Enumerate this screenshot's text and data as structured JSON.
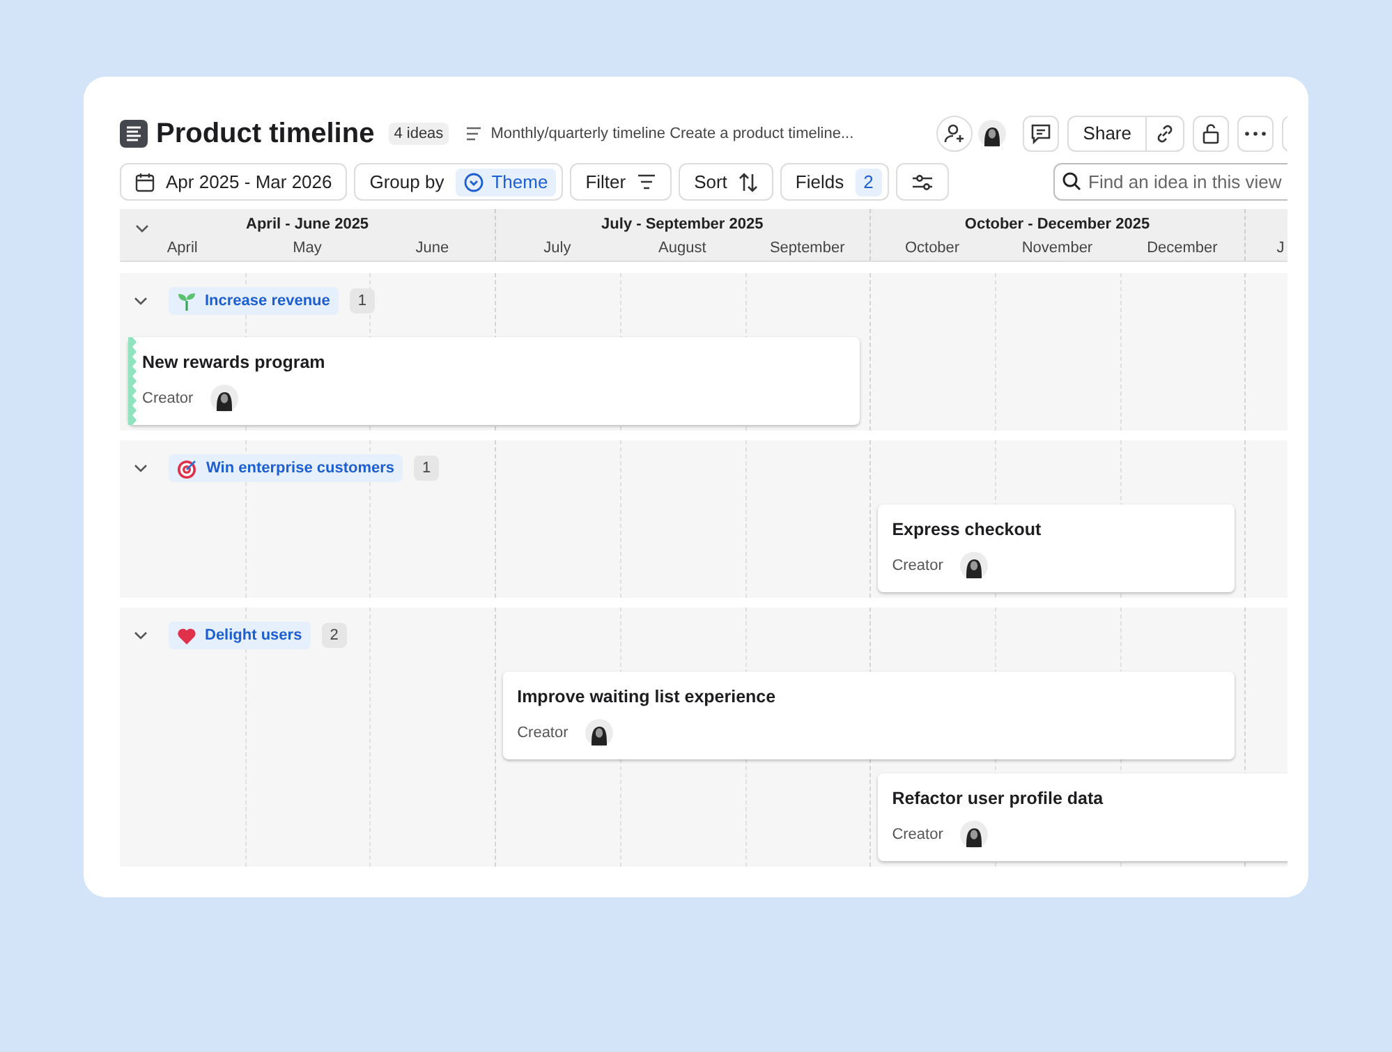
{
  "header": {
    "title": "Product timeline",
    "count_badge": "4 ideas",
    "description": "Monthly/quarterly timeline Create a product timeline...",
    "share_label": "Share"
  },
  "toolbar": {
    "date_range": "Apr 2025 - Mar 2026",
    "group_by_label": "Group by",
    "group_by_value": "Theme",
    "filter_label": "Filter",
    "sort_label": "Sort",
    "fields_label": "Fields",
    "fields_count": "2",
    "search": {
      "placeholder": "Find an idea in this view"
    }
  },
  "timeline": {
    "quarters": [
      {
        "label": "April - June 2025",
        "months": [
          "April",
          "May",
          "June"
        ]
      },
      {
        "label": "July - September 2025",
        "months": [
          "July",
          "August",
          "September"
        ]
      },
      {
        "label": "October - December 2025",
        "months": [
          "October",
          "November",
          "December"
        ]
      },
      {
        "months": [
          "J"
        ]
      }
    ],
    "groups": [
      {
        "label": "Increase revenue",
        "kind": "sprout",
        "count": "1",
        "expanded": true,
        "ideas": [
          {
            "title": "New rewards program",
            "field_label": "Creator",
            "continues_before": true
          }
        ]
      },
      {
        "label": "Win enterprise customers",
        "kind": "target",
        "count": "1",
        "expanded": true,
        "ideas": [
          {
            "title": "Express checkout",
            "field_label": "Creator",
            "continues_before": false
          }
        ]
      },
      {
        "label": "Delight users",
        "kind": "heart",
        "count": "2",
        "expanded": true,
        "ideas": [
          {
            "title": "Improve waiting list experience",
            "field_label": "Creator",
            "continues_before": false
          },
          {
            "title": "Refactor user profile data",
            "field_label": "Creator",
            "continues_before": false
          }
        ]
      }
    ]
  }
}
